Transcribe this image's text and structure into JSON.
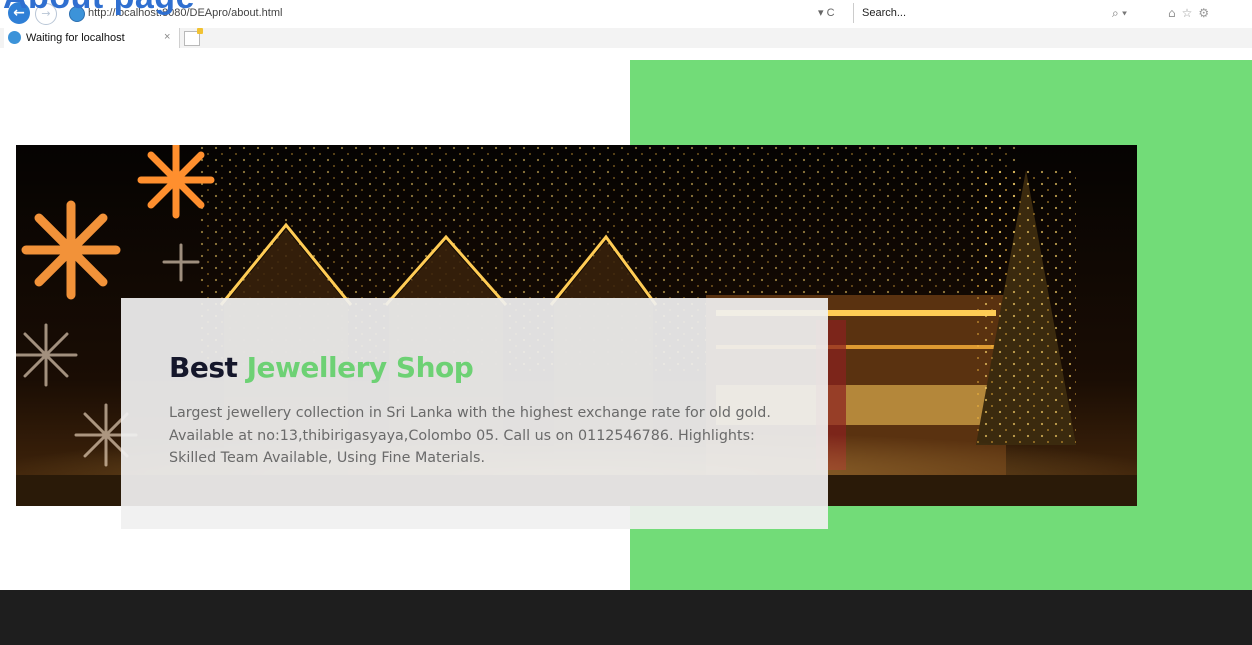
{
  "overlay": {
    "title": "About page"
  },
  "browser": {
    "url": "http://localhost:8080/DEApro/about.html",
    "refresh_glyph": "▾ C",
    "search_placeholder": "Search...",
    "search_icon": "search-icon",
    "tab_title": "Waiting for localhost",
    "tab_close": "×",
    "toolbar_icons": [
      "home-icon",
      "favorites-icon",
      "settings-icon"
    ]
  },
  "about": {
    "heading_word1": "Best",
    "heading_word2": "Jewellery Shop",
    "description": "Largest jewellery collection in Sri Lanka with the highest exchange rate for old gold. Available at no:13,thibirigasyaya,Colombo 05. Call us on 0112546786. Highlights: Skilled Team Available, Using Fine Materials."
  },
  "colors": {
    "accent_green": "#72dc78",
    "heading_dark": "#15172b",
    "heading_green": "#6dd174",
    "footer": "#1e1e1e",
    "browser_blue": "#2f6fd0"
  },
  "images": {
    "hero": "christmas-night-street-with-lights-and-snowflakes"
  }
}
